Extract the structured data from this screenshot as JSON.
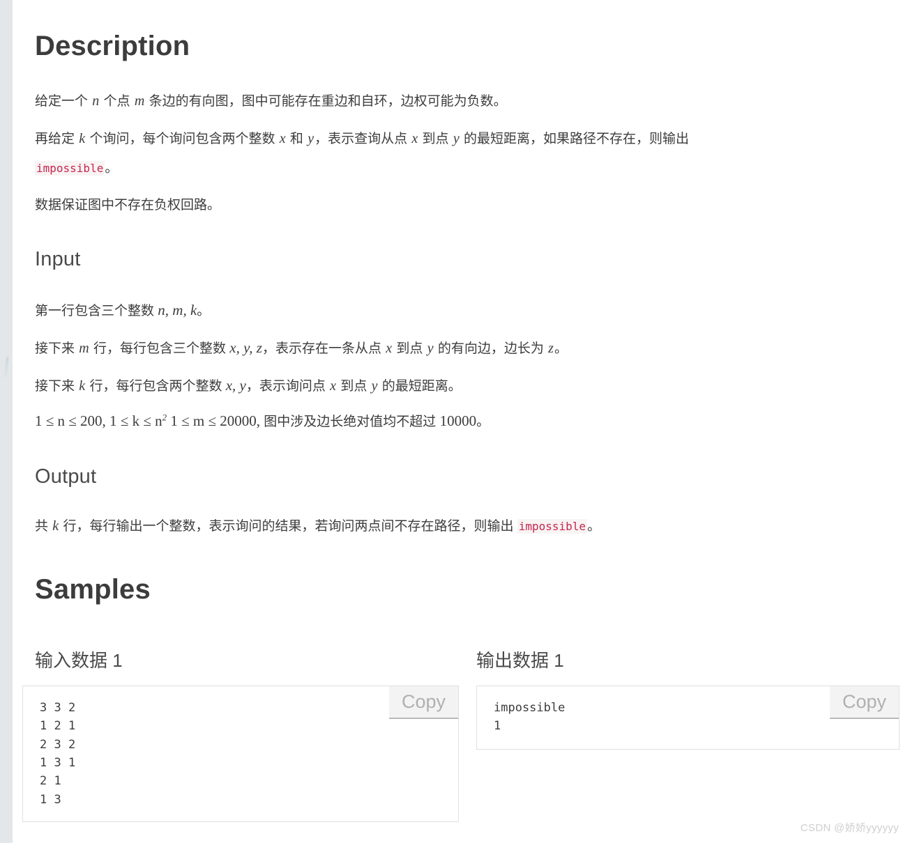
{
  "document": {
    "description_heading": "Description",
    "input_heading": "Input",
    "output_heading": "Output",
    "samples_heading": "Samples",
    "description_paragraphs": {
      "p1_a": "给定一个 ",
      "p1_n": "n",
      "p1_b": " 个点 ",
      "p1_m": "m",
      "p1_c": " 条边的有向图，图中可能存在重边和自环，边权可能为负数。",
      "p2_a": "再给定 ",
      "p2_k": "k",
      "p2_b": " 个询问，每个询问包含两个整数 ",
      "p2_x": "x",
      "p2_c": " 和 ",
      "p2_y": "y",
      "p2_d": "，表示查询从点 ",
      "p2_x2": "x",
      "p2_e": " 到点 ",
      "p2_y2": "y",
      "p2_f": " 的最短距离，如果路径不存在，则输出",
      "p3_code": "impossible",
      "p3_period": "。",
      "p4": "数据保证图中不存在负权回路。"
    },
    "input_section": {
      "line1_a": "第一行包含三个整数 ",
      "line1_math": "n, m, k",
      "line1_b": "。",
      "line2_a": "接下来 ",
      "line2_m": "m",
      "line2_b": " 行，每行包含三个整数 ",
      "line2_math": "x, y, z",
      "line2_c": "，表示存在一条从点 ",
      "line2_x": "x",
      "line2_d": " 到点 ",
      "line2_y": "y",
      "line2_e": " 的有向边，边长为 ",
      "line2_z": "z",
      "line2_f": "。",
      "line3_a": "接下来 ",
      "line3_k": "k",
      "line3_b": " 行，每行包含两个整数 ",
      "line3_math": "x, y",
      "line3_c": "，表示询问点 ",
      "line3_x": "x",
      "line3_d": " 到点 ",
      "line3_y": "y",
      "line3_e": " 的最短距离。",
      "constraint_pre": "1 ≤ n ≤ 200, 1 ≤ k ≤ n",
      "constraint_sup": "2",
      "constraint_mid": " 1 ≤ m ≤ 20000,",
      "constraint_text": " 图中涉及边长绝对值均不超过 ",
      "constraint_num": "10000",
      "constraint_end": "。"
    },
    "output_section": {
      "line_a": "共 ",
      "line_k": "k",
      "line_b": " 行，每行输出一个整数，表示询问的结果，若询问两点间不存在路径，则输出 ",
      "line_code": "impossible",
      "line_c": "。"
    },
    "samples": {
      "input_label": "输入数据 1",
      "output_label": "输出数据 1",
      "copy_label": "Copy",
      "input_data": "3 3 2\n1 2 1\n2 3 2\n1 3 1\n2 1\n1 3",
      "output_data": "impossible\n1"
    },
    "watermark": "CSDN @娇娇yyyyyy",
    "colors": {
      "inline_code_text": "#c7254e",
      "inline_code_bg": "#f8f4f4",
      "heading": "#3c3c3c",
      "body_text": "#3d3d3d",
      "box_border": "#e0e0e0",
      "copy_bg": "#f3f3f3",
      "gutter": "#e3e7e9"
    }
  }
}
